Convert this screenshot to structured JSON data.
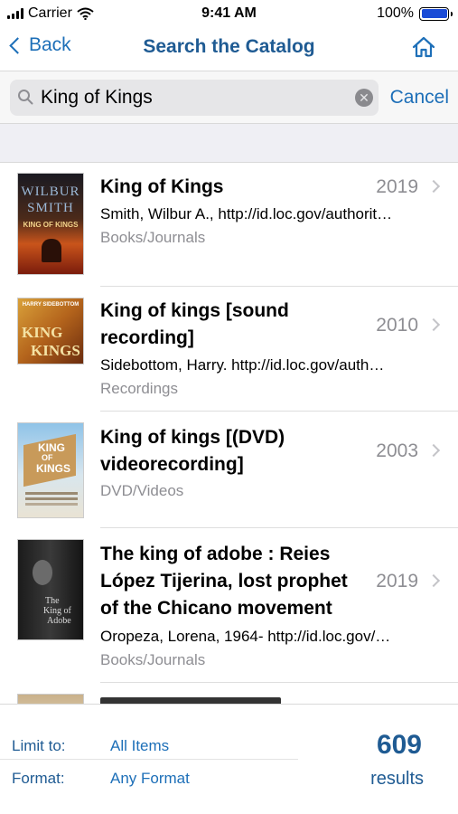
{
  "status_bar": {
    "carrier": "Carrier",
    "time": "9:41 AM",
    "battery": "100%",
    "battery_level": 1.0,
    "icons": [
      "signal-bars-icon",
      "wifi-icon",
      "battery-icon"
    ]
  },
  "nav": {
    "back_label": "Back",
    "title": "Search the Catalog",
    "icons": [
      "chevron-left-icon",
      "home-icon"
    ]
  },
  "search": {
    "query": "King of Kings",
    "cancel_label": "Cancel",
    "icons": [
      "search-icon",
      "clear-icon"
    ]
  },
  "results": [
    {
      "title_lines": [
        "King of Kings"
      ],
      "year": "2019",
      "author": "Smith, Wilbur A., http://id.loc.gov/authorit…",
      "type": "Books/Journals",
      "cover": {
        "line1": "WILBUR",
        "line2": "SMITH",
        "line3": "KING OF KINGS"
      }
    },
    {
      "title_lines": [
        "King of kings [sound",
        "recording]"
      ],
      "year": "2010",
      "author": "Sidebottom, Harry. http://id.loc.gov/auth…",
      "type": "Recordings",
      "cover": {
        "line1": "HARRY SIDEBOTTOM",
        "line2": "KING",
        "line3": "KINGS"
      }
    },
    {
      "title_lines": [
        "King of kings [(DVD)",
        "videorecording]"
      ],
      "year": "2003",
      "author": "",
      "type": "DVD/Videos",
      "cover": {
        "line1": "KING",
        "line2": "OF",
        "line3": "KINGS"
      }
    },
    {
      "title_lines": [
        "The king of adobe : Reies",
        "López Tijerina, lost prophet",
        "of the Chicano movement"
      ],
      "year": "2019",
      "author": "Oropeza, Lorena, 1964- http://id.loc.gov/…",
      "type": "Books/Journals",
      "cover": {
        "line1": "The",
        "line2": "King of",
        "line3": "Adobe"
      }
    }
  ],
  "filters": {
    "limit_label": "Limit to:",
    "limit_value": "All Items",
    "format_label": "Format:",
    "format_value": "Any Format",
    "results_count": "609",
    "results_word": "results"
  },
  "colors": {
    "accent": "#1d6fb8",
    "title_blue": "#1f5b93",
    "secondary_text": "#8e8e93"
  }
}
